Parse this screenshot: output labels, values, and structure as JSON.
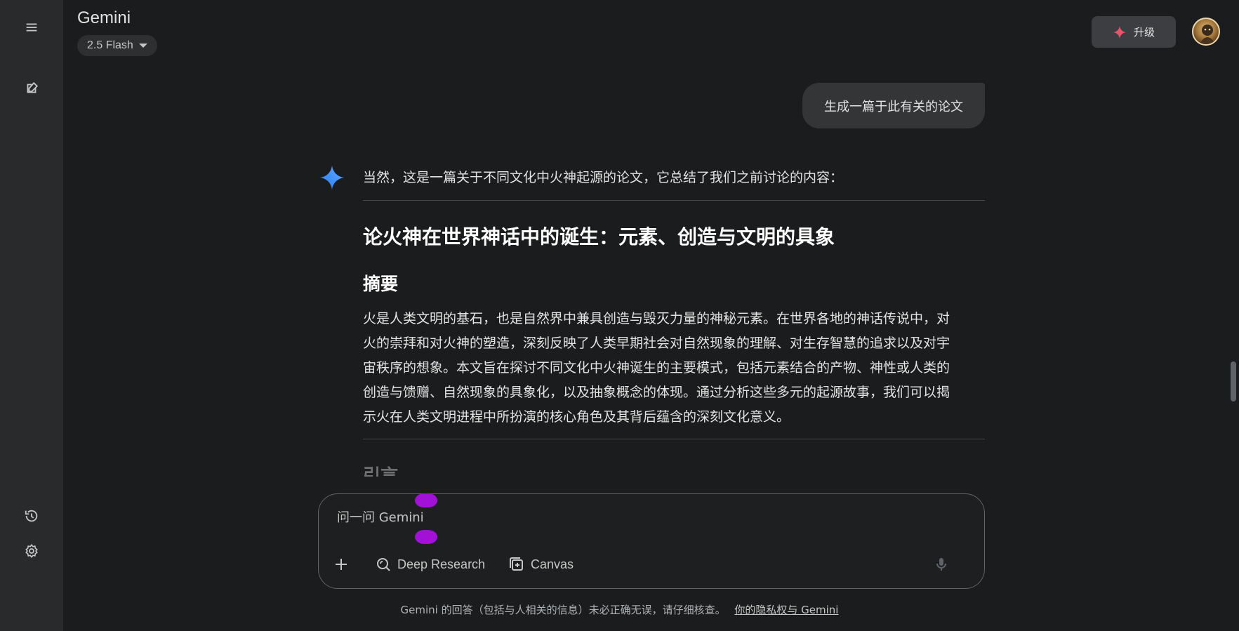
{
  "app": {
    "title": "Gemini",
    "model": "2.5 Flash"
  },
  "sidebar": {
    "menu_icon": "menu-icon",
    "new_chat_icon": "edit-icon",
    "activity_icon": "history-icon",
    "settings_icon": "gear-icon"
  },
  "header": {
    "upgrade_label": "升级",
    "upgrade_icon": "spark-icon"
  },
  "conversation": {
    "user_message": "生成一篇于此有关的论文",
    "response": {
      "intro": "当然，这是一篇关于不同文化中火神起源的论文，它总结了我们之前讨论的内容：",
      "title": "论火神在世界神话中的诞生：元素、创造与文明的具象",
      "abstract_heading": "摘要",
      "abstract_lines": [
        "火是人类文明的基石，也是自然界中兼具创造与毁灭力量的神秘元素。在世界各地的神话传说中，对",
        "火的崇拜和对火神的塑造，深刻反映了人类早期社会对自然现象的理解、对生存智慧的追求以及对宇",
        "宙秩序的想象。本文旨在探讨不同文化中火神诞生的主要模式，包括元素结合的产物、神性或人类的",
        "创造与馈赠、自然现象的具象化，以及抽象概念的体现。通过分析这些多元的起源故事，我们可以揭",
        "示火在人类文明进程中所扮演的核心角色及其背后蕴含的深刻文化意义。"
      ],
      "next_heading": "引言"
    }
  },
  "composer": {
    "placeholder": "问一问 Gemini",
    "tools": {
      "deep_research": "Deep Research",
      "canvas": "Canvas"
    }
  },
  "footer": {
    "disclaimer": "Gemini 的回答（包括与人相关的信息）未必正确无误，请仔细核查。",
    "privacy_link": "你的隐私权与 Gemini"
  },
  "colors": {
    "background": "#1b1c1d",
    "sidebar": "#282a2c",
    "accent_spark": "#e8556b",
    "gemini_blue": "#4285f4",
    "cursor_marker": "#a111d6"
  }
}
